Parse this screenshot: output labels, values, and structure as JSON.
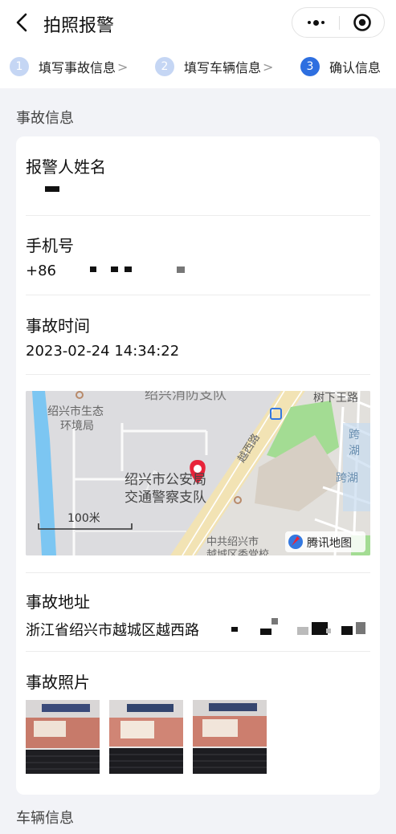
{
  "nav": {
    "title": "拍照报警"
  },
  "steps": [
    {
      "num": "1",
      "label": "填写事故信息",
      "arrow": ">"
    },
    {
      "num": "2",
      "label": "填写车辆信息",
      "arrow": ">"
    },
    {
      "num": "3",
      "label": "确认信息"
    }
  ],
  "accident_section_title": "事故信息",
  "vehicle_section_title": "车辆信息",
  "fields": {
    "reporter_name": {
      "label": "报警人姓名"
    },
    "phone": {
      "label": "手机号",
      "value": "+86"
    },
    "time": {
      "label": "事故时间",
      "value": "2023-02-24 14:34:22"
    },
    "address": {
      "label": "事故地址",
      "value": "浙江省绍兴市越城区越西路"
    },
    "photos": {
      "label": "事故照片"
    }
  },
  "map": {
    "labels": {
      "fire": "绍兴消防支队",
      "eco1": "绍兴市生态",
      "eco2": "环境局",
      "police1": "绍兴市公安局",
      "police2": "交通警察支队",
      "road": "越西路",
      "shuxia": "树下王路",
      "kuahu1": "跨湖",
      "kuahu2": "跨湖",
      "party1": "中共绍兴市",
      "party2": "越城区委党校",
      "scale": "100米",
      "logo": "腾讯地图"
    }
  },
  "colors": {
    "accent": "#2e6fe0",
    "step_inactive": "#c5d6f4",
    "pin": "#e8233a"
  }
}
